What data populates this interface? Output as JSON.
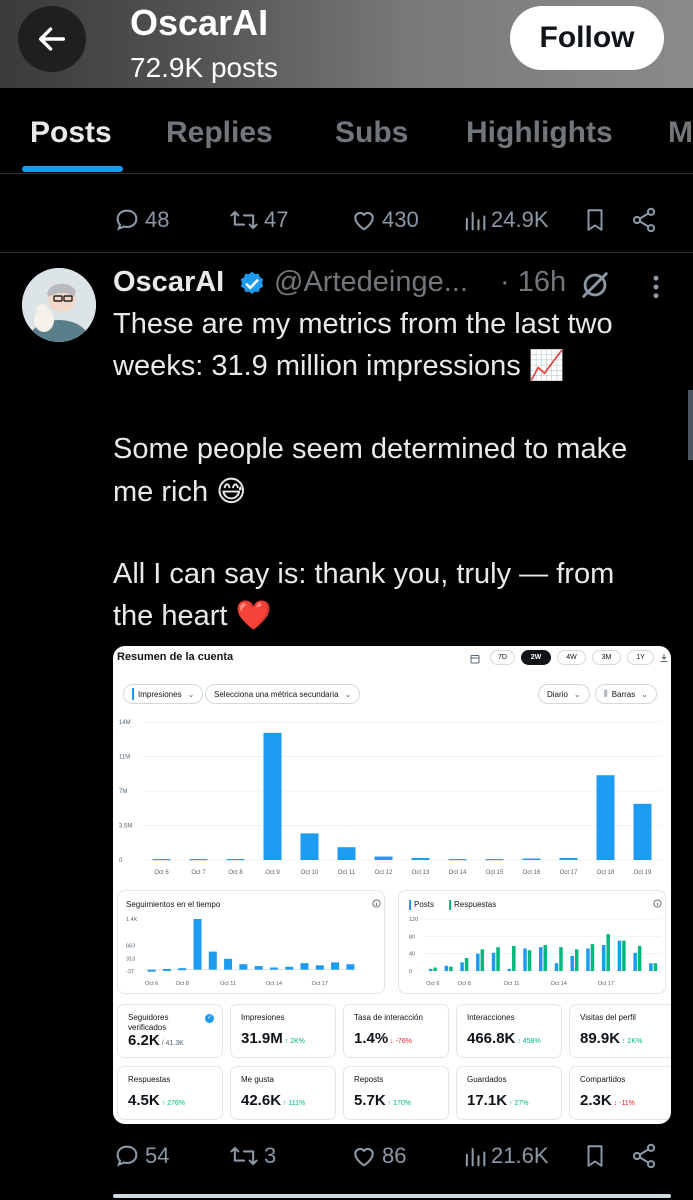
{
  "header": {
    "name": "OscarAI",
    "posts": "72.9K posts",
    "follow": "Follow"
  },
  "tabs": [
    "Posts",
    "Replies",
    "Subs",
    "Highlights",
    "M"
  ],
  "prev_actions": {
    "replies": "48",
    "reposts": "47",
    "likes": "430",
    "views": "24.9K"
  },
  "tweet": {
    "name": "OscarAI",
    "handle": "@Artedeinge...",
    "time": "· 16h",
    "lines": [
      "These are my metrics from the last two",
      "weeks: 31.9 million impressions 📈",
      "Some people seem determined to make",
      "me rich 😅",
      "All I can say is: thank you, truly — from",
      "the heart ❤️"
    ]
  },
  "dashboard": {
    "title": "Resumen de la cuenta",
    "ranges": [
      "7D",
      "2W",
      "4W",
      "3M",
      "1Y"
    ],
    "selected_range": "2W",
    "dropdowns": {
      "metric": "Impresiones",
      "secondary": "Selecciona una métrica secundaria",
      "period": "Diario",
      "style": "Barras"
    },
    "mini1": {
      "title": "Seguimientos en el tiempo",
      "yticks": [
        "1.4K",
        "663",
        "313",
        "-37"
      ],
      "xticks": [
        "Oct 6",
        "Oct 8",
        "Oct 11",
        "Oct 14",
        "Oct 17"
      ]
    },
    "mini2": {
      "legend1": "Posts",
      "legend2": "Respuestas",
      "yticks": [
        "120",
        "80",
        "40",
        "0"
      ],
      "xticks": [
        "Oct 6",
        "Oct 8",
        "Oct 11",
        "Oct 14",
        "Oct 17"
      ]
    },
    "cards": [
      {
        "label": "Seguidores verificados",
        "value": "6.2K",
        "sub": "/ 41.3K",
        "delta": "",
        "dir": ""
      },
      {
        "label": "Impresiones",
        "value": "31.9M",
        "sub": "",
        "delta": "↑ 2K%",
        "dir": "up"
      },
      {
        "label": "Tasa de interacción",
        "value": "1.4%",
        "sub": "",
        "delta": "↓ -76%",
        "dir": "down"
      },
      {
        "label": "Interacciones",
        "value": "466.8K",
        "sub": "",
        "delta": "↑ 458%",
        "dir": "up"
      },
      {
        "label": "Visitas del perfil",
        "value": "89.9K",
        "sub": "",
        "delta": "↑ 2K%",
        "dir": "up"
      },
      {
        "label": "Respuestas",
        "value": "4.5K",
        "sub": "",
        "delta": "↑ 276%",
        "dir": "up"
      },
      {
        "label": "Me gusta",
        "value": "42.6K",
        "sub": "",
        "delta": "↑ 111%",
        "dir": "up"
      },
      {
        "label": "Reposts",
        "value": "5.7K",
        "sub": "",
        "delta": "↑ 170%",
        "dir": "up"
      },
      {
        "label": "Guardados",
        "value": "17.1K",
        "sub": "",
        "delta": "↑ 27%",
        "dir": "up"
      },
      {
        "label": "Compartidos",
        "value": "2.3K",
        "sub": "",
        "delta": "↓ -11%",
        "dir": "down"
      }
    ]
  },
  "tweet_actions": {
    "replies": "54",
    "reposts": "3",
    "likes": "86",
    "views": "21.6K"
  },
  "chart_data": [
    {
      "type": "bar",
      "categories": [
        "Oct 6",
        "Oct 7",
        "Oct 8",
        "Oct 9",
        "Oct 10",
        "Oct 11",
        "Oct 12",
        "Oct 13",
        "Oct 14",
        "Oct 15",
        "Oct 16",
        "Oct 17",
        "Oct 18",
        "Oct 19"
      ],
      "values": [
        0.1,
        0.1,
        0.1,
        12.9,
        2.7,
        1.3,
        0.35,
        0.2,
        0.1,
        0.1,
        0.15,
        0.2,
        8.6,
        5.7
      ],
      "yticks": [
        "14M",
        "11M",
        "7M",
        "3.5M",
        "0"
      ],
      "ylim": [
        0,
        14
      ],
      "color": "#1d9bf0"
    },
    {
      "type": "bar",
      "values": [
        -30,
        20,
        40,
        1400,
        500,
        300,
        150,
        100,
        60,
        80,
        180,
        120,
        200,
        150
      ],
      "ylim": [
        -37,
        1400
      ],
      "color": "#1d9bf0"
    },
    {
      "type": "bar",
      "series": [
        {
          "values": [
            5,
            12,
            20,
            40,
            42,
            5,
            52,
            55,
            18,
            35,
            52,
            60,
            70,
            42,
            18
          ]
        },
        {
          "values": [
            8,
            10,
            30,
            50,
            55,
            58,
            48,
            60,
            55,
            50,
            62,
            85,
            70,
            58,
            18
          ]
        }
      ],
      "ylim": [
        0,
        120
      ],
      "colors": [
        "#1d9bf0",
        "#00ba7c"
      ]
    }
  ]
}
